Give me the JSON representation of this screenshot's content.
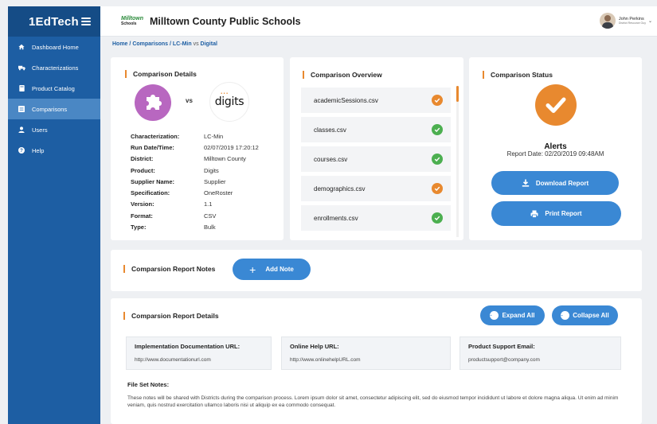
{
  "app": {
    "brand": "1EdTech",
    "district_name": "Milltown County Public Schools",
    "district_logo_line1": "Milltown",
    "district_logo_line2": "Schools"
  },
  "user": {
    "name": "John Perkins",
    "role": "District Resource Guy"
  },
  "sidebar": {
    "items": [
      {
        "label": "Dashboard Home",
        "icon": "home-icon",
        "active": false
      },
      {
        "label": "Characterizations",
        "icon": "truck-icon",
        "active": false
      },
      {
        "label": "Product Catalog",
        "icon": "book-icon",
        "active": false
      },
      {
        "label": "Comparisons",
        "icon": "compare-icon",
        "active": true
      },
      {
        "label": "Users",
        "icon": "user-icon",
        "active": false
      },
      {
        "label": "Help",
        "icon": "help-icon",
        "active": false
      }
    ]
  },
  "breadcrumb": {
    "home": "Home",
    "sep": "/",
    "comparisons": "Comparisons",
    "left": "LC-Min",
    "vs": "vs",
    "right": "Digital"
  },
  "comparison_details": {
    "title": "Comparison Details",
    "vs": "vs",
    "product_logo_text": "digits",
    "rows": [
      {
        "key": "Characterization:",
        "value": "LC-Min"
      },
      {
        "key": "Run Date/Time:",
        "value": "02/07/2019 17:20:12"
      },
      {
        "key": "District:",
        "value": "Milltown County"
      },
      {
        "key": "Product:",
        "value": "Digits"
      },
      {
        "key": "Supplier Name:",
        "value": "Supplier"
      },
      {
        "key": "Specification:",
        "value": "OneRoster"
      },
      {
        "key": "Version:",
        "value": "1.1"
      },
      {
        "key": "Format:",
        "value": "CSV"
      },
      {
        "key": "Type:",
        "value": "Bulk"
      }
    ]
  },
  "comparison_overview": {
    "title": "Comparison Overview",
    "files": [
      {
        "name": "academicSessions.csv",
        "status": "warning"
      },
      {
        "name": "classes.csv",
        "status": "ok"
      },
      {
        "name": "courses.csv",
        "status": "ok"
      },
      {
        "name": "demographics.csv",
        "status": "warning"
      },
      {
        "name": "enrollments.csv",
        "status": "ok"
      }
    ]
  },
  "comparison_status": {
    "title": "Comparison Status",
    "alerts_label": "Alerts",
    "report_date": "Report Date: 02/20/2019 09:48AM",
    "download_label": "Download Report",
    "print_label": "Print Report"
  },
  "report_notes": {
    "title": "Comparsion Report Notes",
    "add_note_label": "Add Note"
  },
  "report_details": {
    "title": "Comparsion Report Details",
    "expand_label": "Expand All",
    "collapse_label": "Collapse All",
    "impl_doc_label": "Implementation Documentation URL:",
    "impl_doc_value": "http://www.documentationurl.com",
    "online_help_label": "Online Help URL:",
    "online_help_value": "http://www.onlinehelpURL.com",
    "support_email_label": "Product Support Email:",
    "support_email_value": "productsupport@company.com",
    "file_set_notes_label": "File Set Notes:",
    "file_set_notes_text": "These notes will be shared with Districts during the comparison process. Lorem ipsum dolor sit amet, consectetur adipiscing elit, sed do eiusmod tempor incididunt ut labore et dolore magna aliqua. Ut enim ad minim veniam, quis nostrud exercitation ullamco laboris nisi ut  aliquip ex ea commodo consequat."
  },
  "colors": {
    "sidebar": "#1d5ea3",
    "sidebar_active": "#4a87c4",
    "accent": "#e8892f",
    "button": "#3a88d4",
    "ok": "#4caf50"
  }
}
